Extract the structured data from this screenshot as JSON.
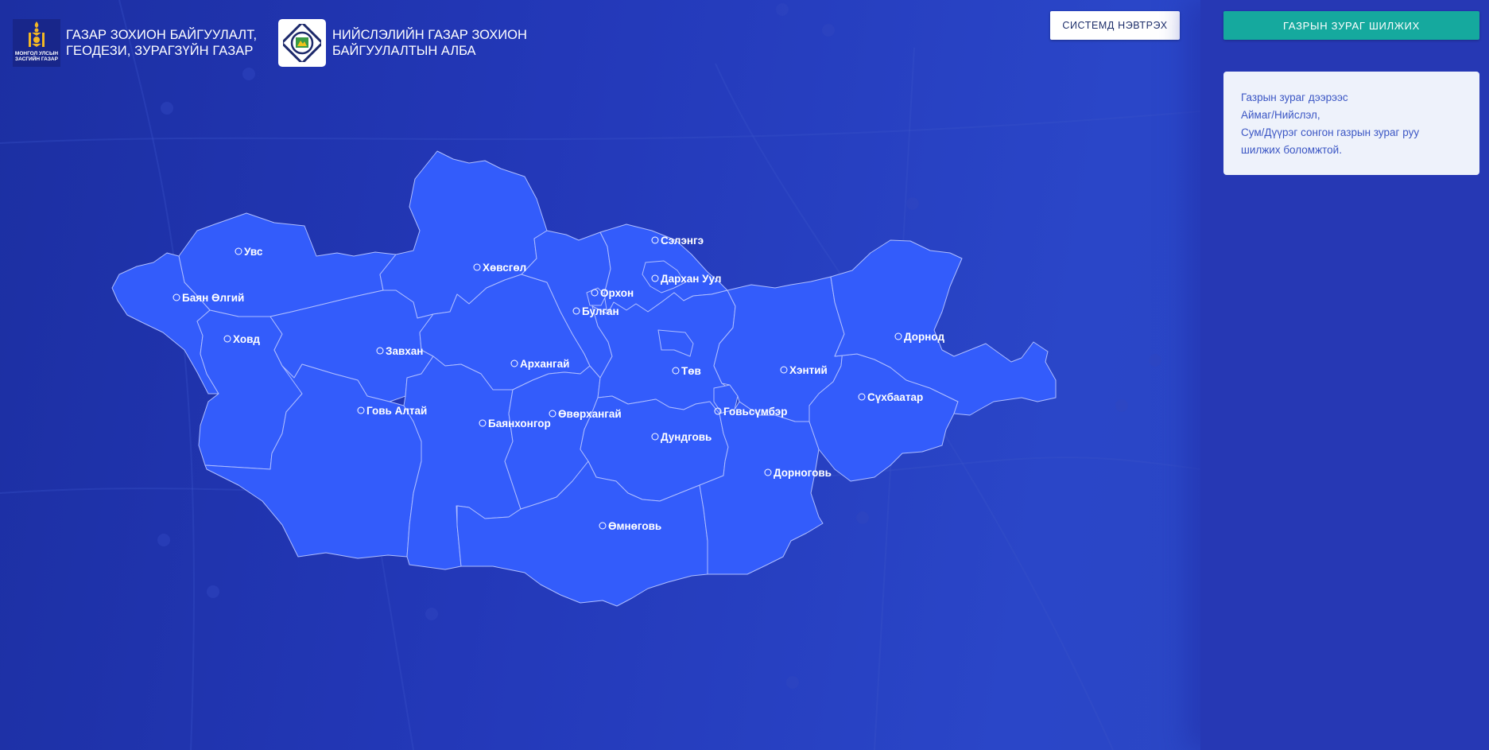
{
  "header": {
    "emblem_text": "МОНГОЛ УЛСЫН\nЗАСГИЙН ГАЗАР",
    "org_title_line1": "ГАЗАР ЗОХИОН БАЙГУУЛАЛТ,",
    "org_title_line2": "ГЕОДЕЗИ, ЗУРАГЗҮЙН ГАЗАР",
    "org2_title_line1": "НИЙСЛЭЛИЙН ГАЗАР ЗОХИОН",
    "org2_title_line2": "БАЙГУУЛАЛТЫН АЛБА",
    "emblem_icon": "soyombo-icon",
    "logo2_icon": "city-land-office-logo-icon"
  },
  "login_button": {
    "label": "СИСТЕМД НЭВТРЭХ"
  },
  "sidebar": {
    "switch_button": {
      "label": "ГАЗРЫН ЗУРАГ ШИЛЖИХ"
    },
    "info_lines": [
      "Газрын зураг дээрээс",
      "Аймаг/Нийслэл,",
      "Сум/Дүүрэг сонгон газрын зураг руу",
      "шилжих боломжтой."
    ]
  },
  "map": {
    "country": "Mongolia",
    "region_fill": "#335cfb",
    "region_border": "#aebdff",
    "labels": [
      "Увс",
      "Баян Өлгий",
      "Ховд",
      "Завхан",
      "Говь Алтай",
      "Хөвсгөл",
      "Архангай",
      "Баянхонгор",
      "Өвөрхангай",
      "Булган",
      "Орхон",
      "Сэлэнгэ",
      "Дархан Уул",
      "Төв",
      "Дундговь",
      "Өмнөговь",
      "Говьсүмбэр",
      "Дорноговь",
      "Хэнтий",
      "Сүхбаатар",
      "Дорнод"
    ]
  },
  "colors": {
    "accent_teal": "#15a99e",
    "background_blue": "#2338b8",
    "info_text": "#3b56c4"
  }
}
